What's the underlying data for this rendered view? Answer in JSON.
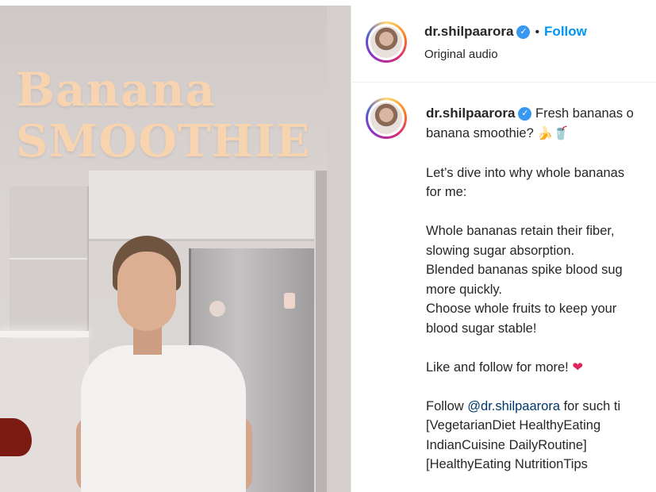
{
  "video": {
    "overlay_line1": "Banana",
    "overlay_line2": "SMOOTHIE"
  },
  "header": {
    "username": "dr.shilpaarora",
    "separator": "•",
    "follow_label": "Follow",
    "audio": "Original audio"
  },
  "caption": {
    "username": "dr.shilpaarora",
    "line1": "Fresh bananas o",
    "line2": "banana smoothie?",
    "line2_emoji": "🍌🥤",
    "line3": "Let’s dive into why whole bananas",
    "line4": "for me:",
    "line5": "Whole bananas retain their fiber,",
    "line6": "slowing sugar absorption.",
    "line7": "Blended bananas spike blood sug",
    "line8": "more quickly.",
    "line9": "Choose whole fruits to keep your",
    "line10": "blood sugar stable!",
    "line11": "Like and follow for more!",
    "line11_emoji": "❤",
    "line12_prefix": "Follow ",
    "line12_mention": "@dr.shilpaarora",
    "line12_suffix": " for such ti",
    "line13": "[VegetarianDiet HealthyEating",
    "line14": "IndianCuisine DailyRoutine]",
    "line15": "[HealthyEating NutritionTips"
  },
  "colors": {
    "accent": "#0095f6",
    "verified": "#3897f0",
    "overlay_text": "#f7d3b0",
    "heart": "#e0245e"
  },
  "icons": [
    "verified-badge-icon",
    "avatar"
  ]
}
